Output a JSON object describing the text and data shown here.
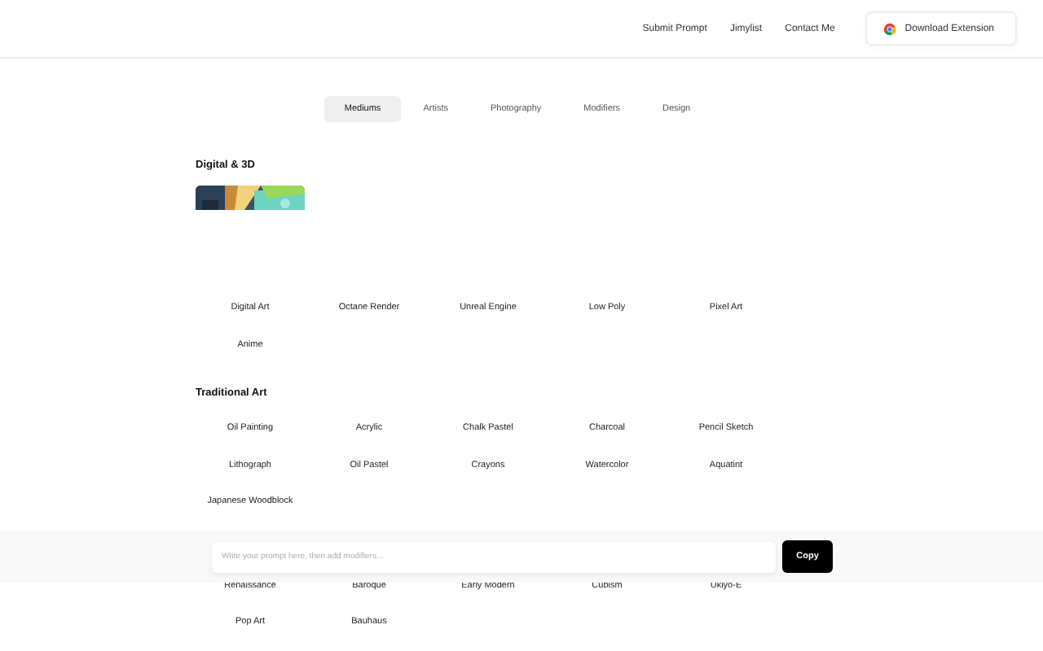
{
  "nav": {
    "links": [
      "Submit Prompt",
      "Jimylist",
      "Contact Me"
    ],
    "download_button": "Download Extension"
  },
  "tabs": [
    {
      "label": "Mediums",
      "selected": true
    },
    {
      "label": "Artists",
      "selected": false
    },
    {
      "label": "Photography",
      "selected": false
    },
    {
      "label": "Modifiers",
      "selected": false
    },
    {
      "label": "Design",
      "selected": false
    }
  ],
  "sections": [
    {
      "title": "Digital & 3D",
      "preview": {
        "kind": "picture"
      },
      "rows": [
        [
          "Digital Art",
          "Octane Render",
          "Unreal Engine",
          "Low Poly",
          "Pixel Art"
        ],
        [
          "Anime"
        ]
      ]
    },
    {
      "title": "Traditional Art",
      "rows": [
        [
          "Oil Painting",
          "Acrylic",
          "Chalk Pastel",
          "Charcoal",
          "Pencil Sketch"
        ],
        [
          "Lithograph",
          "Oil Pastel",
          "Crayons",
          "Watercolor",
          "Aquatint"
        ],
        [
          "Japanese Woodblock"
        ]
      ]
    },
    {
      "rows": [
        [
          "Renaissance",
          "Baroque",
          "Early Modern",
          "Cubism",
          "Ukiyo-E"
        ],
        [
          "Pop Art",
          "Bauhaus"
        ]
      ]
    }
  ],
  "prompt_bar": {
    "placeholder": "Write your prompt here, then add modifiers...",
    "button": "Copy"
  }
}
